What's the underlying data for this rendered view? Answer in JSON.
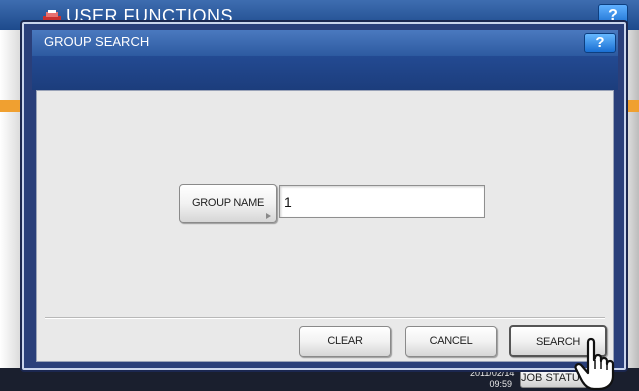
{
  "background": {
    "title": "USER FUNCTIONS",
    "help_label": "?",
    "datetime_date": "2011/02/14",
    "datetime_time": "09:59",
    "job_status_label": "JOB STATUS"
  },
  "dialog": {
    "title": "GROUP SEARCH",
    "help_label": "?",
    "group_name_label": "GROUP NAME",
    "group_name_value": "1",
    "clear_label": "CLEAR",
    "cancel_label": "CANCEL",
    "search_label": "SEARCH"
  },
  "colors": {
    "title_bar": "#2d5aa0",
    "dialog_frame": "#2a3f7a",
    "body": "#e9e9e9",
    "help_button": "#1a6fd2"
  },
  "icons": [
    "user-functions-icon",
    "help-icon",
    "right-arrow-icon",
    "hand-pointer-icon"
  ]
}
